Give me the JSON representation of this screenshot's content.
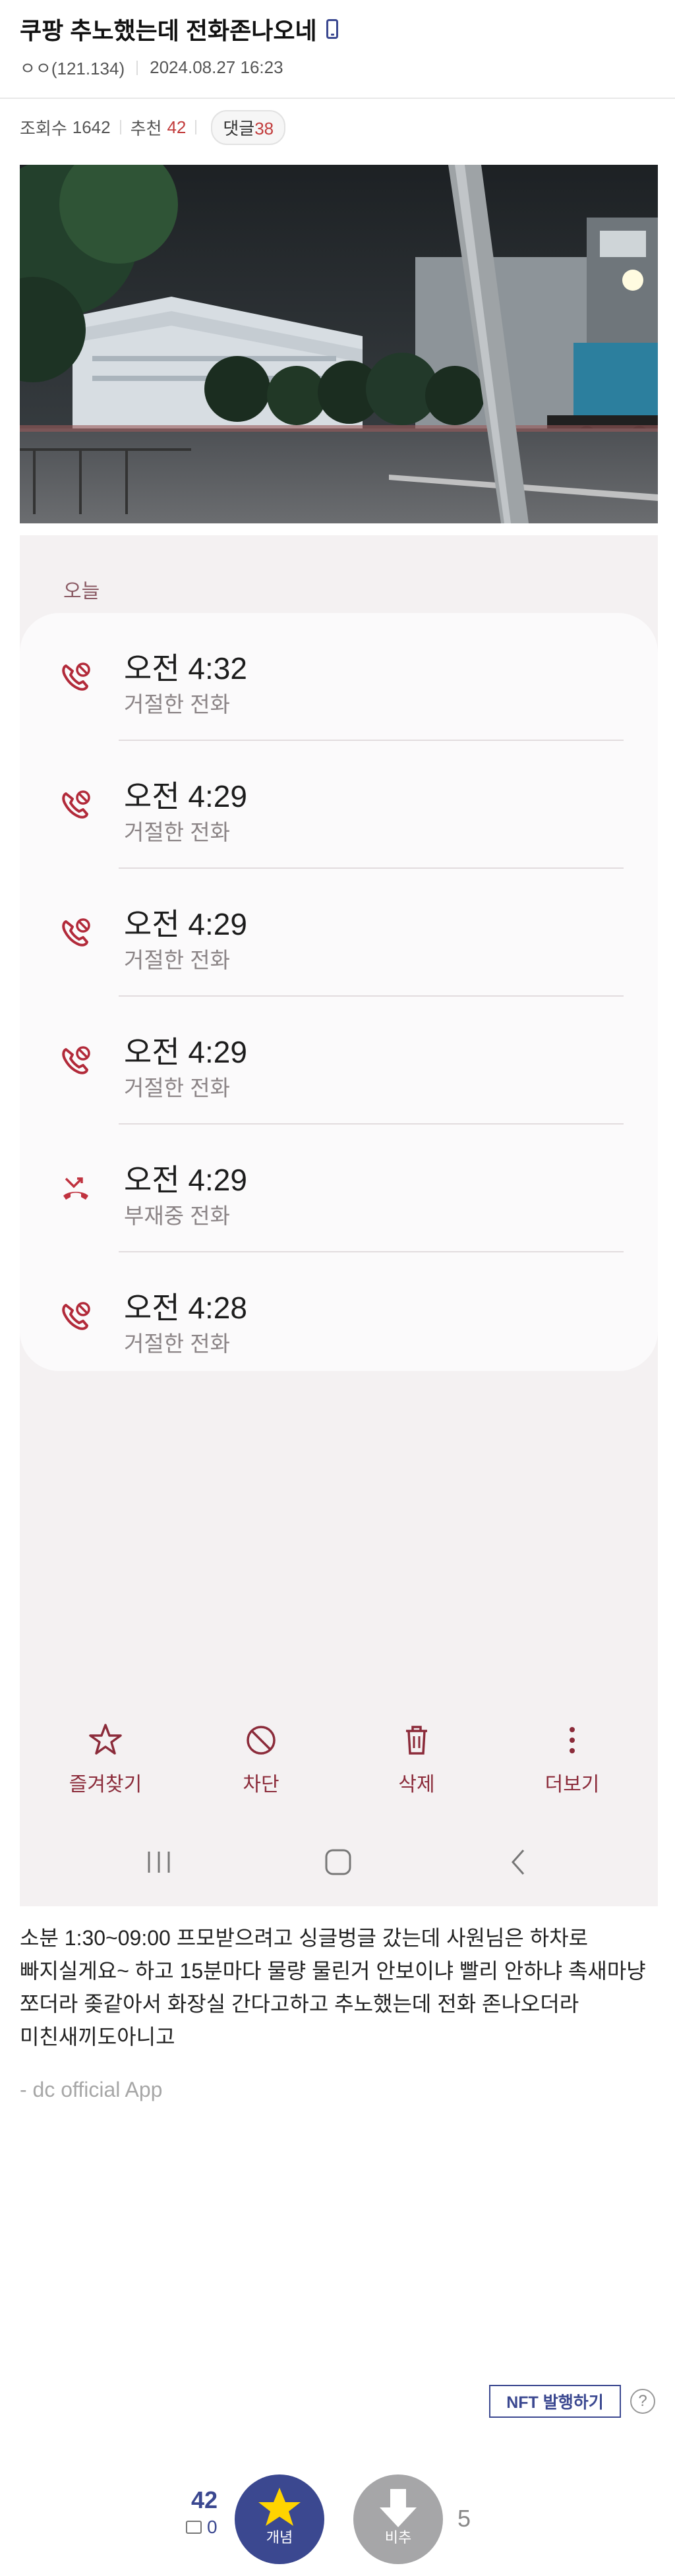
{
  "post": {
    "title": "쿠팡 추노했는데 전화존나오네",
    "author": "ㅇㅇ(121.134)",
    "date": "2024.08.27 16:23",
    "views_label": "조회수",
    "views": "1642",
    "recommend_label": "추천",
    "recommend": "42",
    "comments_label": "댓글",
    "comments": "38"
  },
  "call_log": {
    "section_label": "오늘",
    "calls": [
      {
        "time": "오전 4:32",
        "status": "거절한 전화",
        "icon": "rejected-call-icon"
      },
      {
        "time": "오전 4:29",
        "status": "거절한 전화",
        "icon": "rejected-call-icon"
      },
      {
        "time": "오전 4:29",
        "status": "거절한 전화",
        "icon": "rejected-call-icon"
      },
      {
        "time": "오전 4:29",
        "status": "거절한 전화",
        "icon": "rejected-call-icon"
      },
      {
        "time": "오전 4:29",
        "status": "부재중 전화",
        "icon": "missed-call-icon"
      },
      {
        "time": "오전 4:28",
        "status": "거절한 전화",
        "icon": "rejected-call-icon"
      }
    ],
    "actions": {
      "favorite": "즐겨찾기",
      "block": "차단",
      "delete": "삭제",
      "more": "더보기"
    },
    "accent_color": "#8b2b3a"
  },
  "body": {
    "text": "소분 1:30~09:00 프모받으려고 싱글벙글 갔는데  사원님은 하차로 빠지실게요~ 하고 15분마다 물량 물린거 안보이냐 빨리 안하냐 촉새마냥 쪼더라 좆같아서 화장실 간다고하고 추노했는데 전화 존나오더라 미친새끼도아니고",
    "signature": "- dc official App"
  },
  "nft": {
    "button": "NFT 발행하기",
    "help": "?"
  },
  "votes": {
    "up_count": "42",
    "fixed_count": "0",
    "up_label": "개념",
    "down_label": "비추",
    "down_count": "5",
    "brand_color": "#3b4890"
  }
}
